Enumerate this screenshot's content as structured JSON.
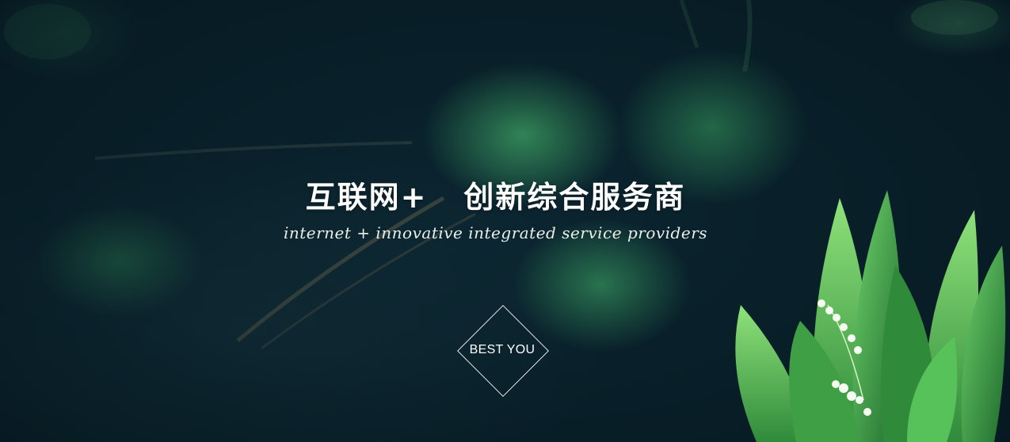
{
  "hero": {
    "title_part1": "互联网+",
    "title_part2": "创新综合服务商",
    "subtitle": "internet + innovative integrated service providers",
    "badge_label": "BEST YOU"
  },
  "colors": {
    "background_dark": "#0b2530",
    "leaf_green": "#3aa064",
    "text": "#ffffff"
  },
  "icons": {
    "badge_shape": "diamond-outline",
    "decoration": "lily-of-the-valley-plant"
  }
}
